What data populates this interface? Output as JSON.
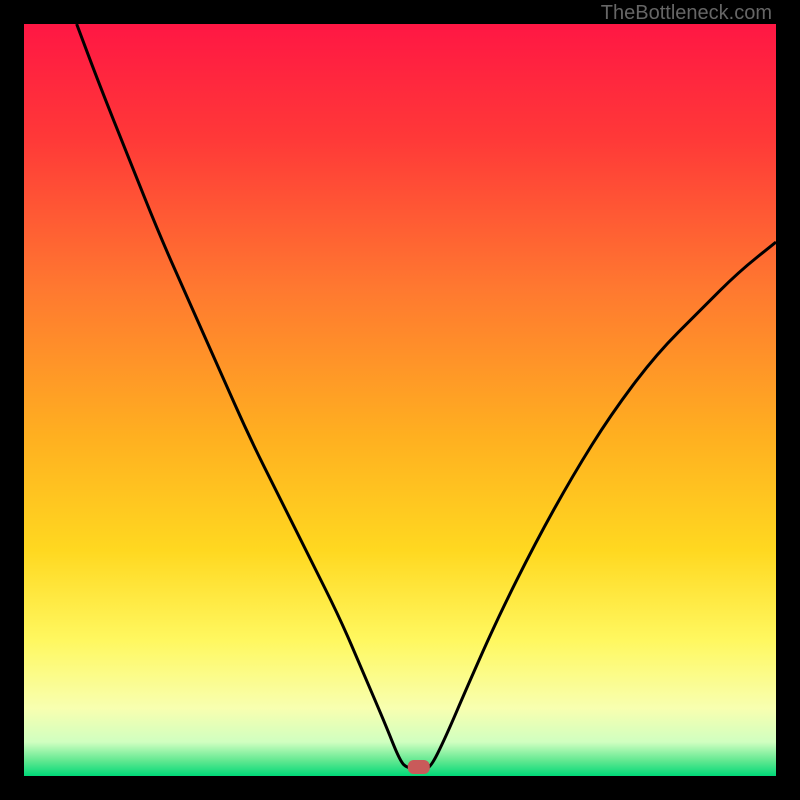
{
  "watermark": "TheBottleneck.com",
  "chart_data": {
    "type": "line",
    "title": "",
    "xlabel": "",
    "ylabel": "",
    "xlim": [
      0,
      100
    ],
    "ylim": [
      0,
      100
    ],
    "description": "Bottleneck curve showing performance mismatch. V-shaped curve with minimum near x=52 where bottleneck is lowest (optimal). Background gradient from red (high bottleneck) at top through orange, yellow, to green (low bottleneck) at bottom.",
    "gradient_stops": [
      {
        "offset": 0.0,
        "color": "#ff1744"
      },
      {
        "offset": 0.15,
        "color": "#ff3838"
      },
      {
        "offset": 0.35,
        "color": "#ff7830"
      },
      {
        "offset": 0.55,
        "color": "#ffb020"
      },
      {
        "offset": 0.7,
        "color": "#ffd820"
      },
      {
        "offset": 0.82,
        "color": "#fff860"
      },
      {
        "offset": 0.91,
        "color": "#f8ffb0"
      },
      {
        "offset": 0.955,
        "color": "#d0ffc0"
      },
      {
        "offset": 0.98,
        "color": "#60e890"
      },
      {
        "offset": 1.0,
        "color": "#00d878"
      }
    ],
    "curve_points": [
      {
        "x": 7,
        "y": 100
      },
      {
        "x": 10,
        "y": 92
      },
      {
        "x": 14,
        "y": 82
      },
      {
        "x": 18,
        "y": 72
      },
      {
        "x": 22,
        "y": 63
      },
      {
        "x": 26,
        "y": 54
      },
      {
        "x": 30,
        "y": 45
      },
      {
        "x": 34,
        "y": 37
      },
      {
        "x": 38,
        "y": 29
      },
      {
        "x": 42,
        "y": 21
      },
      {
        "x": 45,
        "y": 14
      },
      {
        "x": 48,
        "y": 7
      },
      {
        "x": 50,
        "y": 2
      },
      {
        "x": 51,
        "y": 1
      },
      {
        "x": 53,
        "y": 1
      },
      {
        "x": 54,
        "y": 1
      },
      {
        "x": 56,
        "y": 5
      },
      {
        "x": 59,
        "y": 12
      },
      {
        "x": 63,
        "y": 21
      },
      {
        "x": 68,
        "y": 31
      },
      {
        "x": 73,
        "y": 40
      },
      {
        "x": 78,
        "y": 48
      },
      {
        "x": 84,
        "y": 56
      },
      {
        "x": 90,
        "y": 62
      },
      {
        "x": 95,
        "y": 67
      },
      {
        "x": 100,
        "y": 71
      }
    ],
    "marker": {
      "x": 52.5,
      "y": 1.2,
      "color": "#c95a5a"
    }
  }
}
